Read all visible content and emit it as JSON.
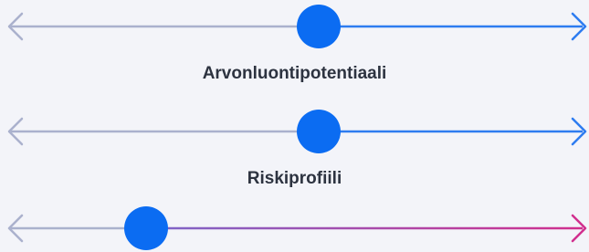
{
  "sliders": [
    {
      "label": "",
      "value": 0.54,
      "left_color": "#aab1cd",
      "right_color": "#2e7cf0"
    },
    {
      "label": "Arvonluontipotentiaali",
      "value": 0.54,
      "left_color": "#aab1cd",
      "right_color": "#2e7cf0"
    },
    {
      "label": "Riskiprofiili",
      "value": 0.24,
      "left_color": "#aab1cd",
      "right_color": "#d12f8e"
    }
  ],
  "thumb_color": "#0b6cf2",
  "icons": {
    "left_arrow": "chevron-left-icon",
    "right_arrow": "chevron-right-icon"
  }
}
